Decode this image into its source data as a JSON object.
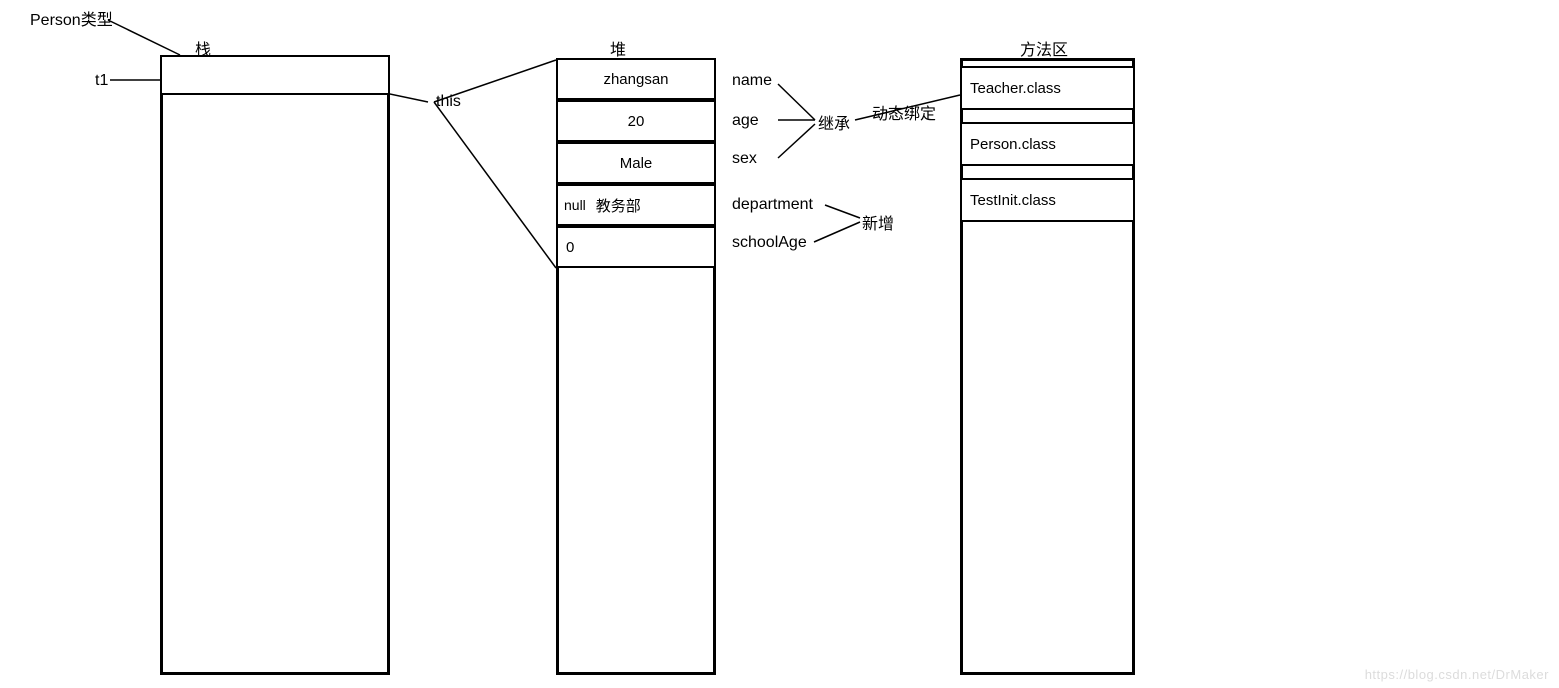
{
  "labels": {
    "person_type": "Person类型",
    "t1": "t1",
    "stack_title": "栈",
    "heap_title": "堆",
    "method_area_title": "方法区",
    "this": "this",
    "inherit": "继承",
    "dynamic_binding": "动态绑定",
    "new_added": "新增",
    "watermark": "https://blog.csdn.net/DrMaker"
  },
  "heap": {
    "fields": [
      {
        "value": "zhangsan",
        "name": "name"
      },
      {
        "value": "20",
        "name": "age"
      },
      {
        "value": "Male",
        "name": "sex"
      },
      {
        "value": "教务部",
        "prefix": "null",
        "name": "department"
      },
      {
        "value": "0",
        "name": "schoolAge"
      }
    ]
  },
  "method_area": {
    "classes": [
      "Teacher.class",
      "Person.class",
      "TestInit.class"
    ]
  }
}
